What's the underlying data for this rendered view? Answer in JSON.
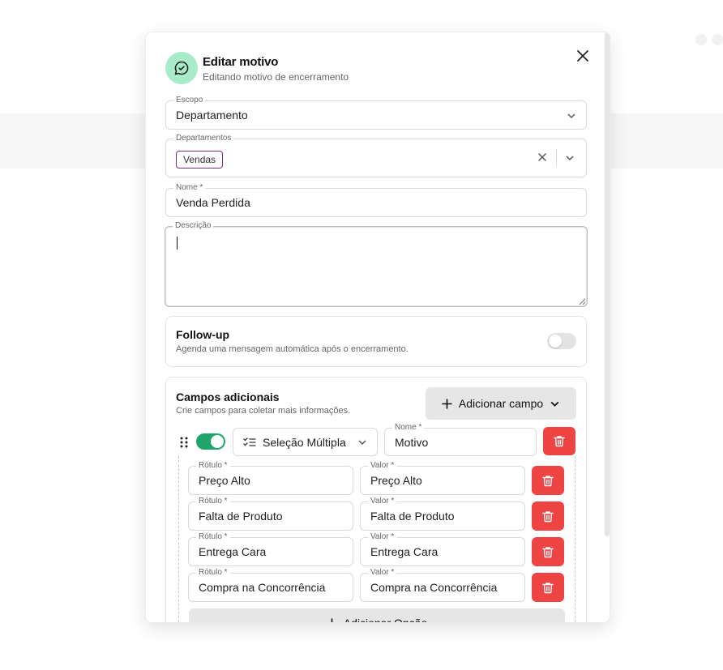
{
  "modal": {
    "title": "Editar motivo",
    "subtitle": "Editando motivo de encerramento"
  },
  "scope": {
    "label": "Escopo",
    "value": "Departamento"
  },
  "departments": {
    "label": "Departamentos",
    "chips": [
      "Vendas"
    ]
  },
  "name": {
    "label": "Nome *",
    "value": "Venda Perdida"
  },
  "description": {
    "label": "Descrição",
    "value": ""
  },
  "followup": {
    "title": "Follow-up",
    "description": "Agenda uma mensagem automática após o encerramento.",
    "enabled": false
  },
  "extra_fields": {
    "title": "Campos adicionais",
    "description": "Crie campos para coletar mais informações.",
    "add_button": "Adicionar campo",
    "field": {
      "enabled": true,
      "type": "Seleção Múltipla",
      "name_label": "Nome *",
      "name_value": "Motivo",
      "option_label_caption": "Rótulo *",
      "option_value_caption": "Valor *",
      "options": [
        {
          "label": "Preço Alto",
          "value": "Preço Alto"
        },
        {
          "label": "Falta de Produto",
          "value": "Falta de Produto"
        },
        {
          "label": "Entrega Cara",
          "value": "Entrega Cara"
        },
        {
          "label": "Compra na Concorrência",
          "value": "Compra na Concorrência"
        }
      ],
      "add_option_button": "Adicionar Opção"
    }
  },
  "colors": {
    "accent_green": "#1fa56b",
    "icon_bg": "#a8ebc8",
    "delete_red": "#ef4444",
    "chip_border": "#7b2d7b"
  }
}
